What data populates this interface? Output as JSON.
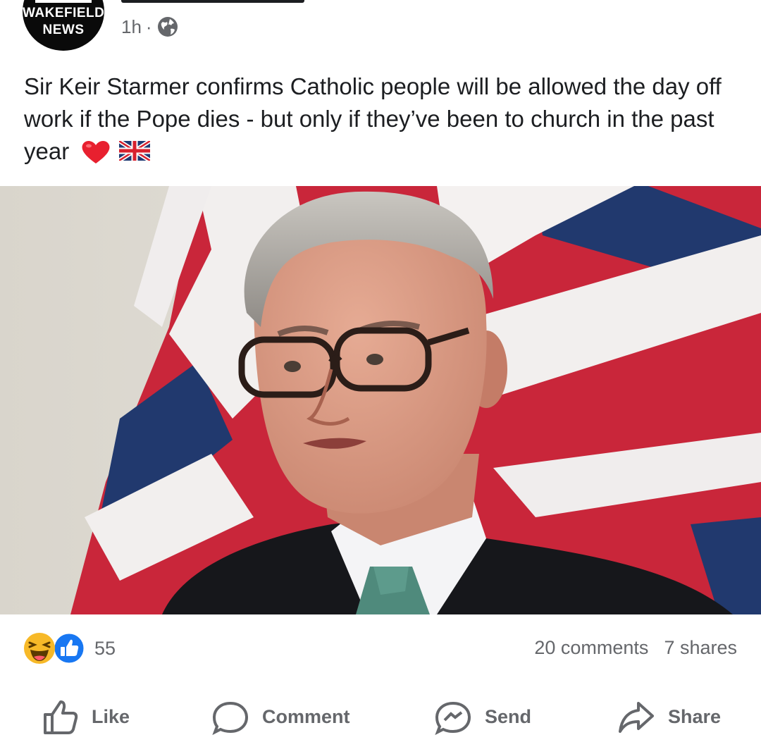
{
  "post": {
    "page_name": "Wakefield News",
    "avatar_line1": "WAKEFIELD",
    "avatar_line2": "NEWS",
    "time": "1h",
    "separator": "·",
    "text": "Sir Keir Starmer confirms Catholic people will be allowed the day off work if the Pope dies - but only if they’ve been to church in the past year",
    "emoji": [
      "heart-emoji",
      "uk-flag-emoji"
    ]
  },
  "stats": {
    "reaction_count": "55",
    "reactions": [
      "haha-reaction-icon",
      "like-reaction-icon"
    ],
    "comments": "20 comments",
    "shares": "7 shares"
  },
  "actions": [
    {
      "label": "Like",
      "icon": "like-icon"
    },
    {
      "label": "Comment",
      "icon": "comment-icon"
    },
    {
      "label": "Send",
      "icon": "send-icon"
    },
    {
      "label": "Share",
      "icon": "share-icon"
    }
  ],
  "colors": {
    "text": "#1c1e21",
    "secondary": "#65676b",
    "like_blue": "#1877f2",
    "haha_yellow": "#f7b928",
    "flag_red": "#d8212e",
    "flag_blue": "#1f3a73"
  }
}
